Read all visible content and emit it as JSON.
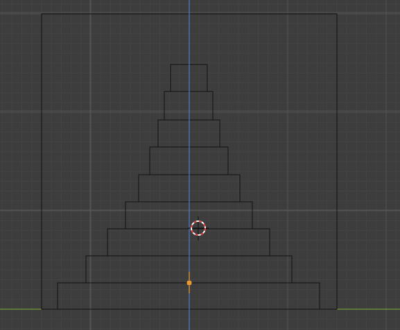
{
  "viewport": {
    "view": "front-orthographic",
    "grid": true,
    "colors": {
      "background": "#3d3d3d",
      "grid_minor": "#444444",
      "grid_major": "#545454",
      "axis_z": "#4f7cc9",
      "axis_x": "#7fb33a",
      "wire": "#111111",
      "origin": "#e8982e",
      "cursor_red": "#e03a3a",
      "cursor_white": "#ffffff"
    }
  },
  "scene": {
    "objects": [
      {
        "name": "frame-object",
        "type": "rectangle-wire"
      },
      {
        "name": "stepped-pyramid",
        "type": "stacked-boxes",
        "tiers": 9
      }
    ],
    "origin_marker": {
      "name": "object-origin",
      "type": "origin-point"
    },
    "cursor_3d": {
      "name": "3d-cursor",
      "type": "cursor"
    }
  }
}
